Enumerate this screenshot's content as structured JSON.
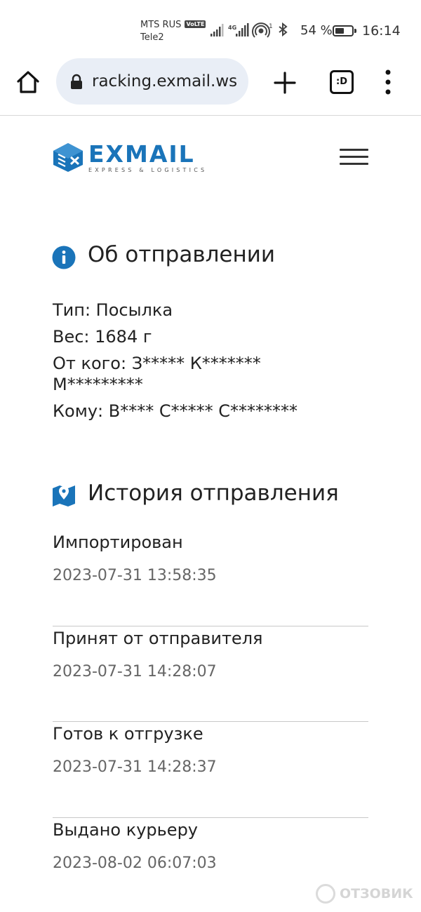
{
  "status_bar": {
    "carrier1": "MTS RUS",
    "volte": "VoLTE",
    "carrier2": "Tele2",
    "network_small": "4G",
    "sim_index": "1",
    "battery_percent": "54 %",
    "battery_level": 0.54,
    "time": "16:14"
  },
  "browser": {
    "url": "racking.exmail.ws",
    "tab_switcher_label": ":D",
    "home_icon": "home-icon",
    "lock_icon": "lock-icon",
    "new_tab_icon": "plus-icon",
    "menu_icon": "more-vert-icon"
  },
  "site": {
    "logo_text": "EXMAIL",
    "logo_subtitle": "EXPRESS & LOGISTICS",
    "brand_color": "#1a74b9"
  },
  "shipment_info": {
    "title": "Об отправлении",
    "icon": "info-icon",
    "type_line": "Тип: Посылка",
    "weight_line": "Вес: 1684 г",
    "from_line_1": "От кого: З***** К*******",
    "from_line_2": "М*********",
    "to_line": "Кому: В**** С***** С********"
  },
  "history": {
    "title": "История отправления",
    "icon": "map-pin-icon",
    "events": [
      {
        "status": "Импортирован",
        "date": "2023-07-31 13:58:35"
      },
      {
        "status": "Принят от отправителя",
        "date": "2023-07-31 14:28:07"
      },
      {
        "status": "Готов к отгрузке",
        "date": "2023-07-31 14:28:37"
      },
      {
        "status": "Выдано курьеру",
        "date": "2023-08-02 06:07:03"
      }
    ]
  },
  "watermark": {
    "text": "ОТЗОВИК"
  }
}
